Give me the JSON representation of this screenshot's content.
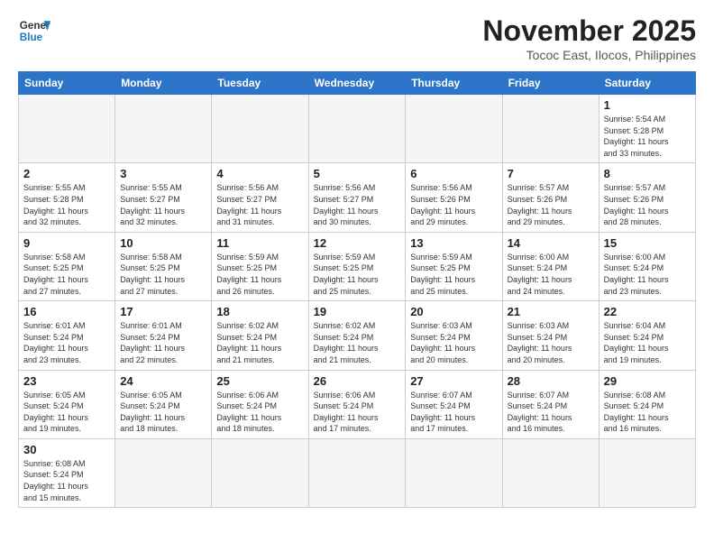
{
  "header": {
    "logo_general": "General",
    "logo_blue": "Blue",
    "month_title": "November 2025",
    "subtitle": "Tococ East, Ilocos, Philippines"
  },
  "weekdays": [
    "Sunday",
    "Monday",
    "Tuesday",
    "Wednesday",
    "Thursday",
    "Friday",
    "Saturday"
  ],
  "weeks": [
    [
      {
        "day": "",
        "info": ""
      },
      {
        "day": "",
        "info": ""
      },
      {
        "day": "",
        "info": ""
      },
      {
        "day": "",
        "info": ""
      },
      {
        "day": "",
        "info": ""
      },
      {
        "day": "",
        "info": ""
      },
      {
        "day": "1",
        "info": "Sunrise: 5:54 AM\nSunset: 5:28 PM\nDaylight: 11 hours\nand 33 minutes."
      }
    ],
    [
      {
        "day": "2",
        "info": "Sunrise: 5:55 AM\nSunset: 5:28 PM\nDaylight: 11 hours\nand 32 minutes."
      },
      {
        "day": "3",
        "info": "Sunrise: 5:55 AM\nSunset: 5:27 PM\nDaylight: 11 hours\nand 32 minutes."
      },
      {
        "day": "4",
        "info": "Sunrise: 5:56 AM\nSunset: 5:27 PM\nDaylight: 11 hours\nand 31 minutes."
      },
      {
        "day": "5",
        "info": "Sunrise: 5:56 AM\nSunset: 5:27 PM\nDaylight: 11 hours\nand 30 minutes."
      },
      {
        "day": "6",
        "info": "Sunrise: 5:56 AM\nSunset: 5:26 PM\nDaylight: 11 hours\nand 29 minutes."
      },
      {
        "day": "7",
        "info": "Sunrise: 5:57 AM\nSunset: 5:26 PM\nDaylight: 11 hours\nand 29 minutes."
      },
      {
        "day": "8",
        "info": "Sunrise: 5:57 AM\nSunset: 5:26 PM\nDaylight: 11 hours\nand 28 minutes."
      }
    ],
    [
      {
        "day": "9",
        "info": "Sunrise: 5:58 AM\nSunset: 5:25 PM\nDaylight: 11 hours\nand 27 minutes."
      },
      {
        "day": "10",
        "info": "Sunrise: 5:58 AM\nSunset: 5:25 PM\nDaylight: 11 hours\nand 27 minutes."
      },
      {
        "day": "11",
        "info": "Sunrise: 5:59 AM\nSunset: 5:25 PM\nDaylight: 11 hours\nand 26 minutes."
      },
      {
        "day": "12",
        "info": "Sunrise: 5:59 AM\nSunset: 5:25 PM\nDaylight: 11 hours\nand 25 minutes."
      },
      {
        "day": "13",
        "info": "Sunrise: 5:59 AM\nSunset: 5:25 PM\nDaylight: 11 hours\nand 25 minutes."
      },
      {
        "day": "14",
        "info": "Sunrise: 6:00 AM\nSunset: 5:24 PM\nDaylight: 11 hours\nand 24 minutes."
      },
      {
        "day": "15",
        "info": "Sunrise: 6:00 AM\nSunset: 5:24 PM\nDaylight: 11 hours\nand 23 minutes."
      }
    ],
    [
      {
        "day": "16",
        "info": "Sunrise: 6:01 AM\nSunset: 5:24 PM\nDaylight: 11 hours\nand 23 minutes."
      },
      {
        "day": "17",
        "info": "Sunrise: 6:01 AM\nSunset: 5:24 PM\nDaylight: 11 hours\nand 22 minutes."
      },
      {
        "day": "18",
        "info": "Sunrise: 6:02 AM\nSunset: 5:24 PM\nDaylight: 11 hours\nand 21 minutes."
      },
      {
        "day": "19",
        "info": "Sunrise: 6:02 AM\nSunset: 5:24 PM\nDaylight: 11 hours\nand 21 minutes."
      },
      {
        "day": "20",
        "info": "Sunrise: 6:03 AM\nSunset: 5:24 PM\nDaylight: 11 hours\nand 20 minutes."
      },
      {
        "day": "21",
        "info": "Sunrise: 6:03 AM\nSunset: 5:24 PM\nDaylight: 11 hours\nand 20 minutes."
      },
      {
        "day": "22",
        "info": "Sunrise: 6:04 AM\nSunset: 5:24 PM\nDaylight: 11 hours\nand 19 minutes."
      }
    ],
    [
      {
        "day": "23",
        "info": "Sunrise: 6:05 AM\nSunset: 5:24 PM\nDaylight: 11 hours\nand 19 minutes."
      },
      {
        "day": "24",
        "info": "Sunrise: 6:05 AM\nSunset: 5:24 PM\nDaylight: 11 hours\nand 18 minutes."
      },
      {
        "day": "25",
        "info": "Sunrise: 6:06 AM\nSunset: 5:24 PM\nDaylight: 11 hours\nand 18 minutes."
      },
      {
        "day": "26",
        "info": "Sunrise: 6:06 AM\nSunset: 5:24 PM\nDaylight: 11 hours\nand 17 minutes."
      },
      {
        "day": "27",
        "info": "Sunrise: 6:07 AM\nSunset: 5:24 PM\nDaylight: 11 hours\nand 17 minutes."
      },
      {
        "day": "28",
        "info": "Sunrise: 6:07 AM\nSunset: 5:24 PM\nDaylight: 11 hours\nand 16 minutes."
      },
      {
        "day": "29",
        "info": "Sunrise: 6:08 AM\nSunset: 5:24 PM\nDaylight: 11 hours\nand 16 minutes."
      }
    ],
    [
      {
        "day": "30",
        "info": "Sunrise: 6:08 AM\nSunset: 5:24 PM\nDaylight: 11 hours\nand 15 minutes."
      },
      {
        "day": "",
        "info": ""
      },
      {
        "day": "",
        "info": ""
      },
      {
        "day": "",
        "info": ""
      },
      {
        "day": "",
        "info": ""
      },
      {
        "day": "",
        "info": ""
      },
      {
        "day": "",
        "info": ""
      }
    ]
  ]
}
